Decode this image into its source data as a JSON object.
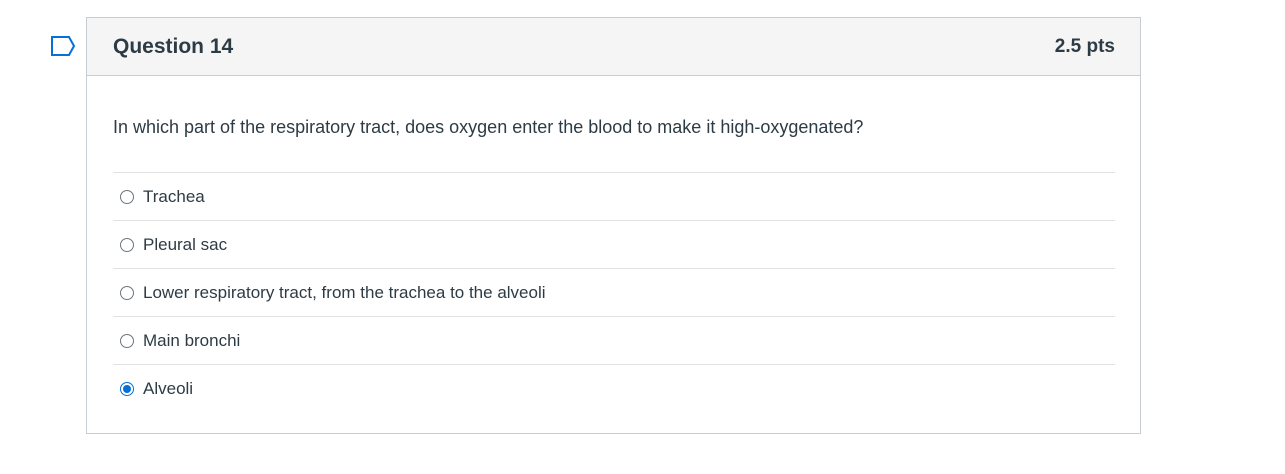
{
  "question": {
    "title": "Question 14",
    "points": "2.5 pts",
    "flag_icon": "bookmark-flag-icon",
    "text": "In which part of the respiratory tract, does oxygen enter the blood to make it high-oxygenated?",
    "answers": [
      {
        "label": "Trachea",
        "selected": false
      },
      {
        "label": "Pleural sac",
        "selected": false
      },
      {
        "label": "Lower respiratory tract, from the trachea to the alveoli",
        "selected": false
      },
      {
        "label": "Main bronchi",
        "selected": false
      },
      {
        "label": "Alveoli",
        "selected": true
      }
    ]
  },
  "colors": {
    "accent": "#0770d8",
    "text": "#2d3b45",
    "header_bg": "#f5f5f5",
    "border": "#c7cdd1"
  }
}
